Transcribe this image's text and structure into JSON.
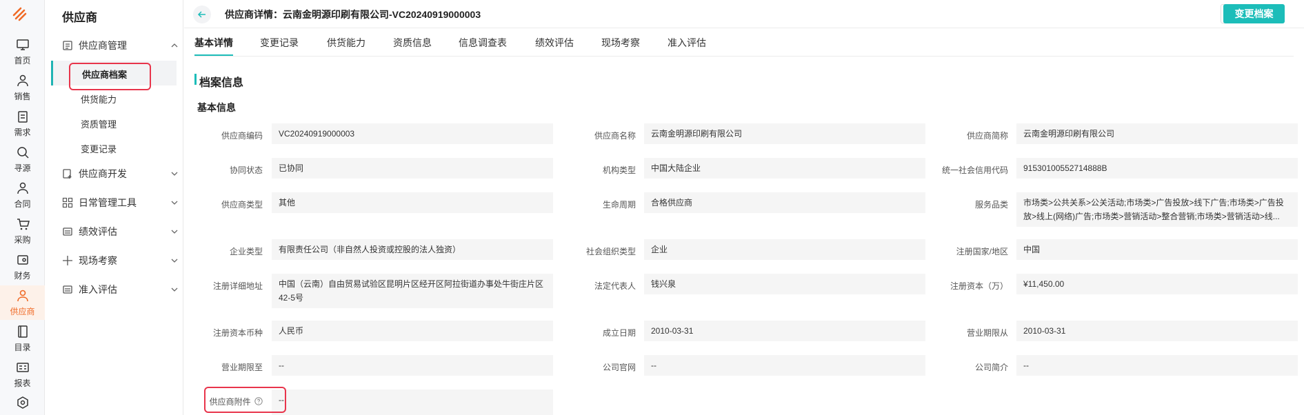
{
  "rail": {
    "items": [
      {
        "label": "首页",
        "icon": "monitor-icon"
      },
      {
        "label": "销售",
        "icon": "person-icon"
      },
      {
        "label": "需求",
        "icon": "clipboard-icon"
      },
      {
        "label": "寻源",
        "icon": "search-icon"
      },
      {
        "label": "合同",
        "icon": "person-icon"
      },
      {
        "label": "采购",
        "icon": "cart-icon"
      },
      {
        "label": "财务",
        "icon": "wallet-icon"
      },
      {
        "label": "供应商",
        "icon": "supplier-icon"
      },
      {
        "label": "目录",
        "icon": "catalog-icon"
      },
      {
        "label": "报表",
        "icon": "report-icon"
      },
      {
        "label": "",
        "icon": "settings-icon"
      }
    ],
    "active_color": "#f06a26"
  },
  "sidebar": {
    "title": "供应商",
    "groups": [
      {
        "label": "供应商管理",
        "icon": "list-icon",
        "expanded": true
      },
      {
        "label": "供应商开发",
        "icon": "add-doc-icon"
      },
      {
        "label": "日常管理工具",
        "icon": "grid-icon"
      },
      {
        "label": "绩效评估",
        "icon": "form-icon"
      },
      {
        "label": "现场考察",
        "icon": "plus-icon"
      },
      {
        "label": "准入评估",
        "icon": "form-icon"
      }
    ],
    "sub_items": [
      "供应商档案",
      "供货能力",
      "资质管理",
      "变更记录"
    ]
  },
  "header": {
    "title": "供应商详情：云南金明源印刷有限公司-VC20240919000003",
    "action_label": "变更档案",
    "accent_color": "#1cbdb9"
  },
  "tabs": [
    "基本详情",
    "变更记录",
    "供货能力",
    "资质信息",
    "信息调查表",
    "绩效评估",
    "现场考察",
    "准入评估"
  ],
  "content": {
    "section_title": "档案信息",
    "sub_title": "基本信息",
    "fields": [
      {
        "label": "供应商编码",
        "value": "VC20240919000003"
      },
      {
        "label": "供应商名称",
        "value": "云南金明源印刷有限公司"
      },
      {
        "label": "供应商简称",
        "value": "云南金明源印刷有限公司"
      },
      {
        "label": "协同状态",
        "value": "已协同"
      },
      {
        "label": "机构类型",
        "value": "中国大陆企业"
      },
      {
        "label": "统一社会信用代码",
        "value": "91530100552714888B"
      },
      {
        "label": "供应商类型",
        "value": "其他"
      },
      {
        "label": "生命周期",
        "value": "合格供应商"
      },
      {
        "label": "服务品类",
        "value": "市场类>公共关系>公关活动;市场类>广告投放>线下广告;市场类>广告投放>线上(网络)广告;市场类>营销活动>整合营销;市场类>营销活动>线..."
      },
      {
        "label": "企业类型",
        "value": "有限责任公司（非自然人投资或控股的法人独资）"
      },
      {
        "label": "社会组织类型",
        "value": "企业"
      },
      {
        "label": "注册国家/地区",
        "value": "中国"
      },
      {
        "label": "注册详细地址",
        "value": "中国（云南）自由贸易试验区昆明片区经开区阿拉街道办事处牛街庄片区42-5号"
      },
      {
        "label": "法定代表人",
        "value": "钱兴泉"
      },
      {
        "label": "注册资本（万）",
        "value": "¥11,450.00"
      },
      {
        "label": "注册资本币种",
        "value": "人民币"
      },
      {
        "label": "成立日期",
        "value": "2010-03-31"
      },
      {
        "label": "营业期限从",
        "value": "2010-03-31"
      },
      {
        "label": "营业期限至",
        "value": "--"
      },
      {
        "label": "公司官网",
        "value": "--"
      },
      {
        "label": "公司简介",
        "value": "--"
      },
      {
        "label": "供应商附件",
        "value": "--"
      }
    ]
  }
}
